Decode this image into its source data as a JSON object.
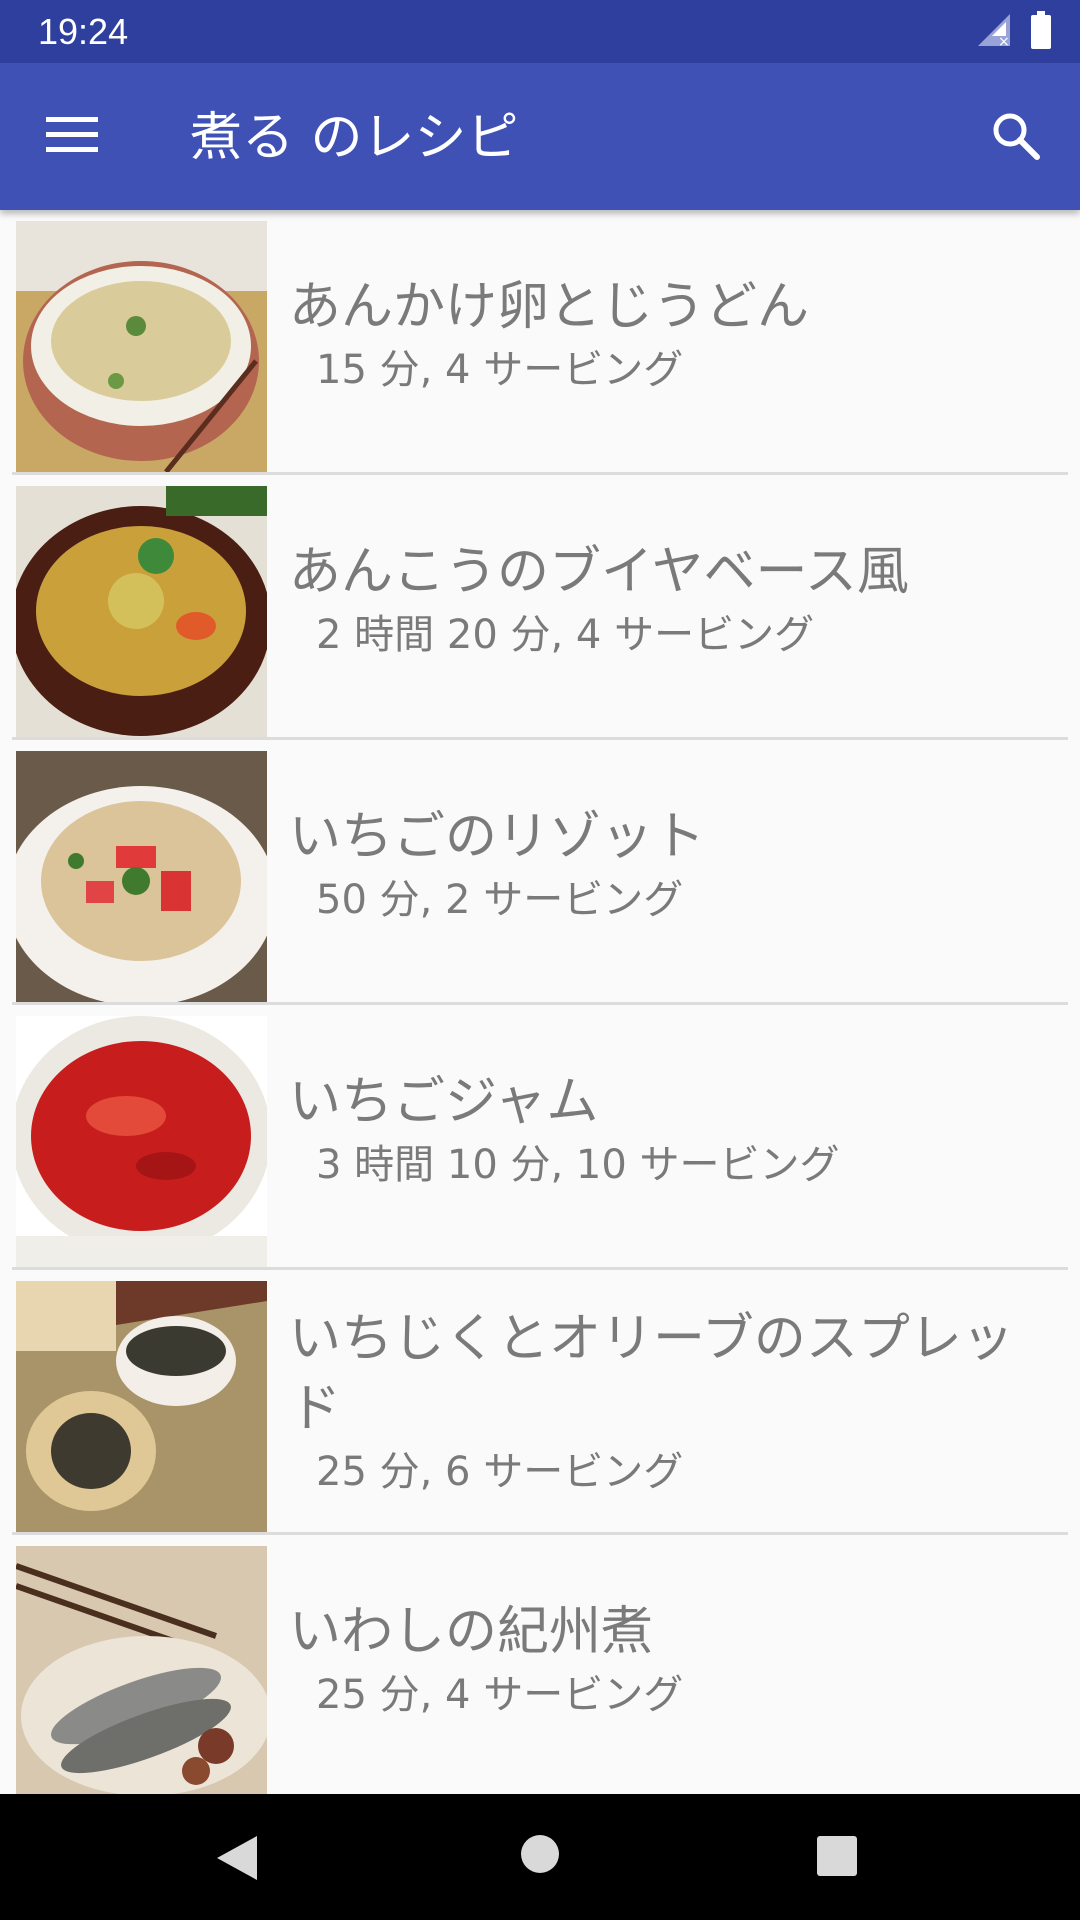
{
  "status_bar": {
    "time": "19:24",
    "icons": [
      "signal-no-data-icon",
      "battery-icon"
    ]
  },
  "app_bar": {
    "title": "煮る のレシピ",
    "menu_icon": "menu-icon",
    "search_icon": "search-icon",
    "color": "#3f51b5",
    "status_color": "#2f3f9e"
  },
  "recipes": [
    {
      "name": "あんかけ卵とじうどん",
      "meta": "15 分, 4 サービング"
    },
    {
      "name": "あんこうのブイヤベース風",
      "meta": "2 時間 20 分, 4 サービング"
    },
    {
      "name": "いちごのリゾット",
      "meta": "50 分, 2 サービング"
    },
    {
      "name": "いちごジャム",
      "meta": "3 時間 10 分, 10 サービング"
    },
    {
      "name_line1": "いちじくとオリーブのスプレッ",
      "name_line2": "ド",
      "meta": "25 分, 6 サービング"
    },
    {
      "name": "いわしの紀州煮",
      "meta": "25 分, 4 サービング"
    }
  ],
  "nav_bar": {
    "icons": [
      "back-triangle-icon",
      "home-circle-icon",
      "recents-square-icon"
    ]
  }
}
